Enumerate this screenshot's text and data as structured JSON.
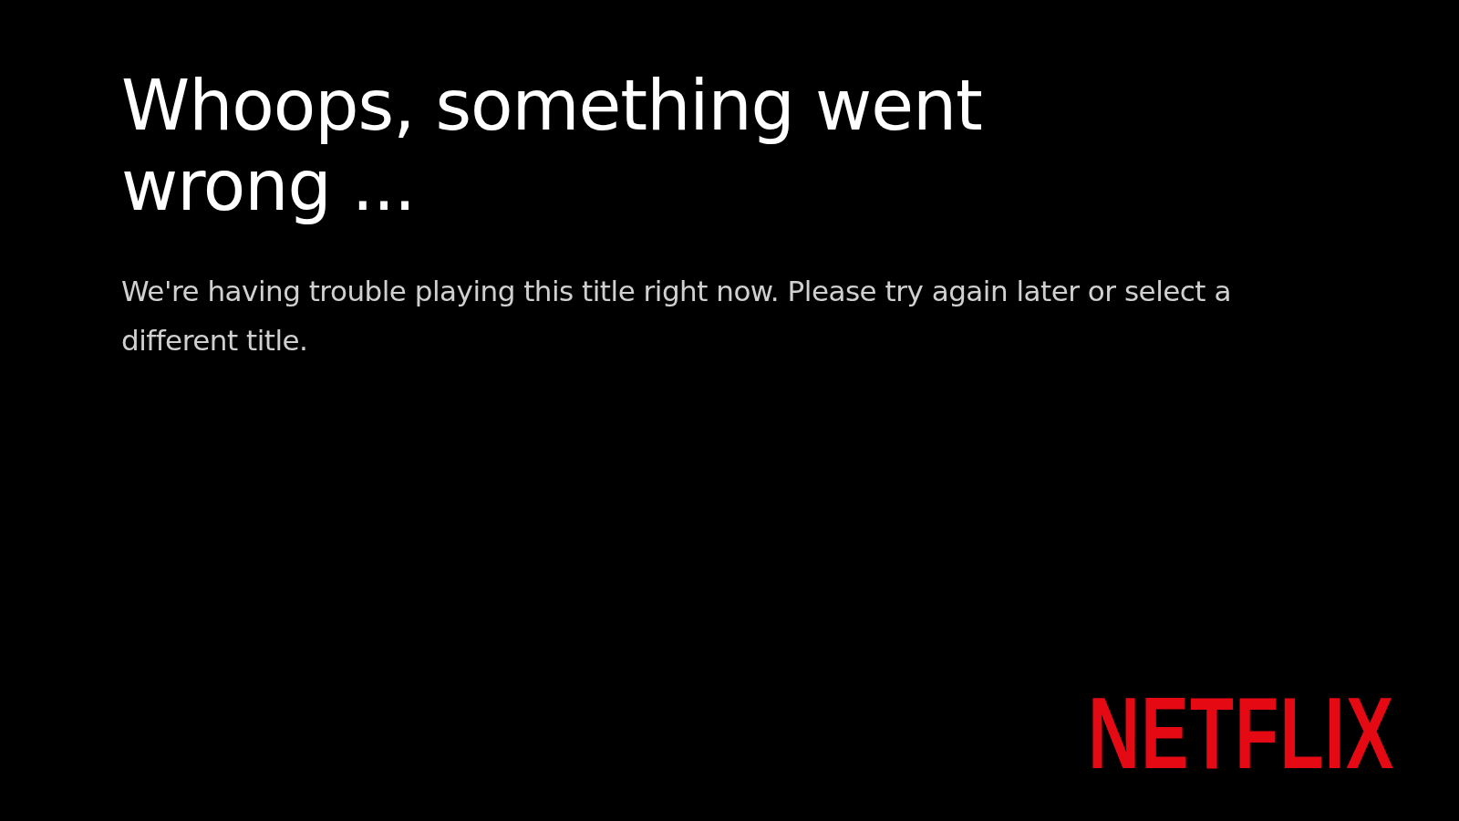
{
  "error": {
    "title": "Whoops, something went wrong ...",
    "message": "We're having trouble playing this title right now. Please try again later or select a different title."
  },
  "logo": {
    "text": "NETFLIX"
  }
}
